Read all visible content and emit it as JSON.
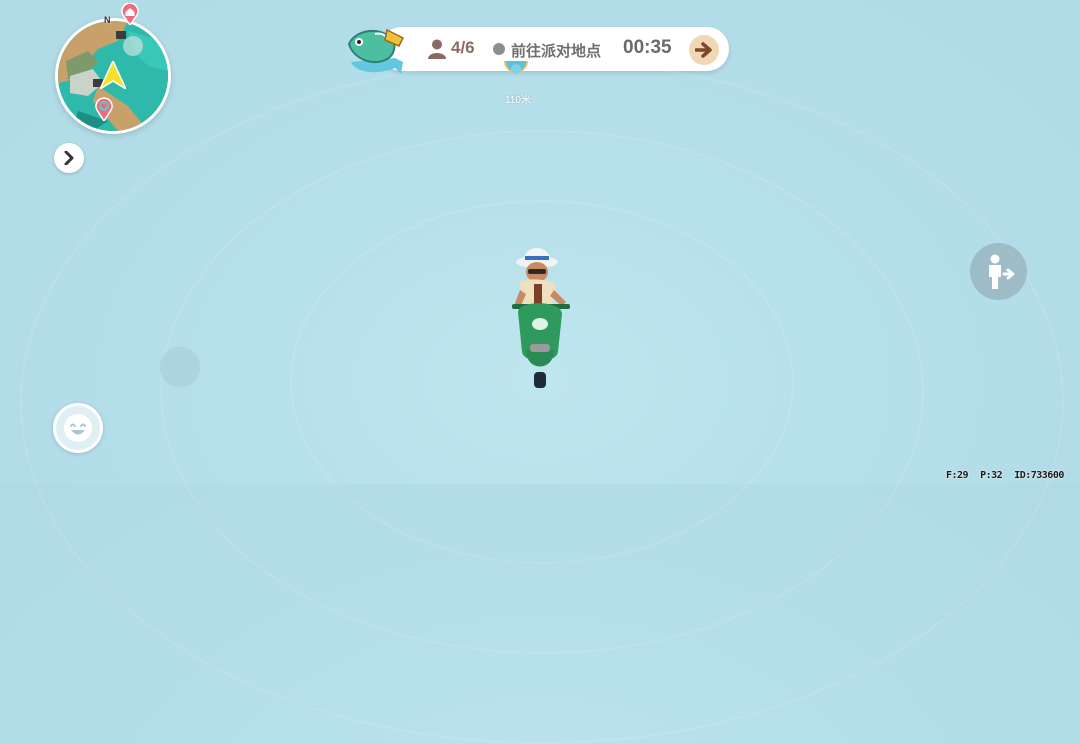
{
  "minimap": {
    "compass_label": "N",
    "icons": [
      "home-icon",
      "destination-heart-icon",
      "player-arrow-icon"
    ]
  },
  "banner": {
    "badge_icon": "fish-badge-icon",
    "player_count": "4/6",
    "status_text": "前往派对地点",
    "timer": "00:35",
    "go_icon": "arrow-right-icon"
  },
  "waypoint": {
    "distance": "110米"
  },
  "controls": {
    "expand_icon": "chevron-right-icon",
    "dismount_icon": "person-exit-icon",
    "emote_icon": "smiley-face-icon",
    "joystick": "virtual-joystick"
  },
  "debug": {
    "fps": "F:29",
    "ping": "P:32",
    "id": "ID:733600"
  },
  "colors": {
    "sky": "#b6e0ea",
    "accent": "#f1d7b5",
    "scooter": "#2f9a5e"
  }
}
